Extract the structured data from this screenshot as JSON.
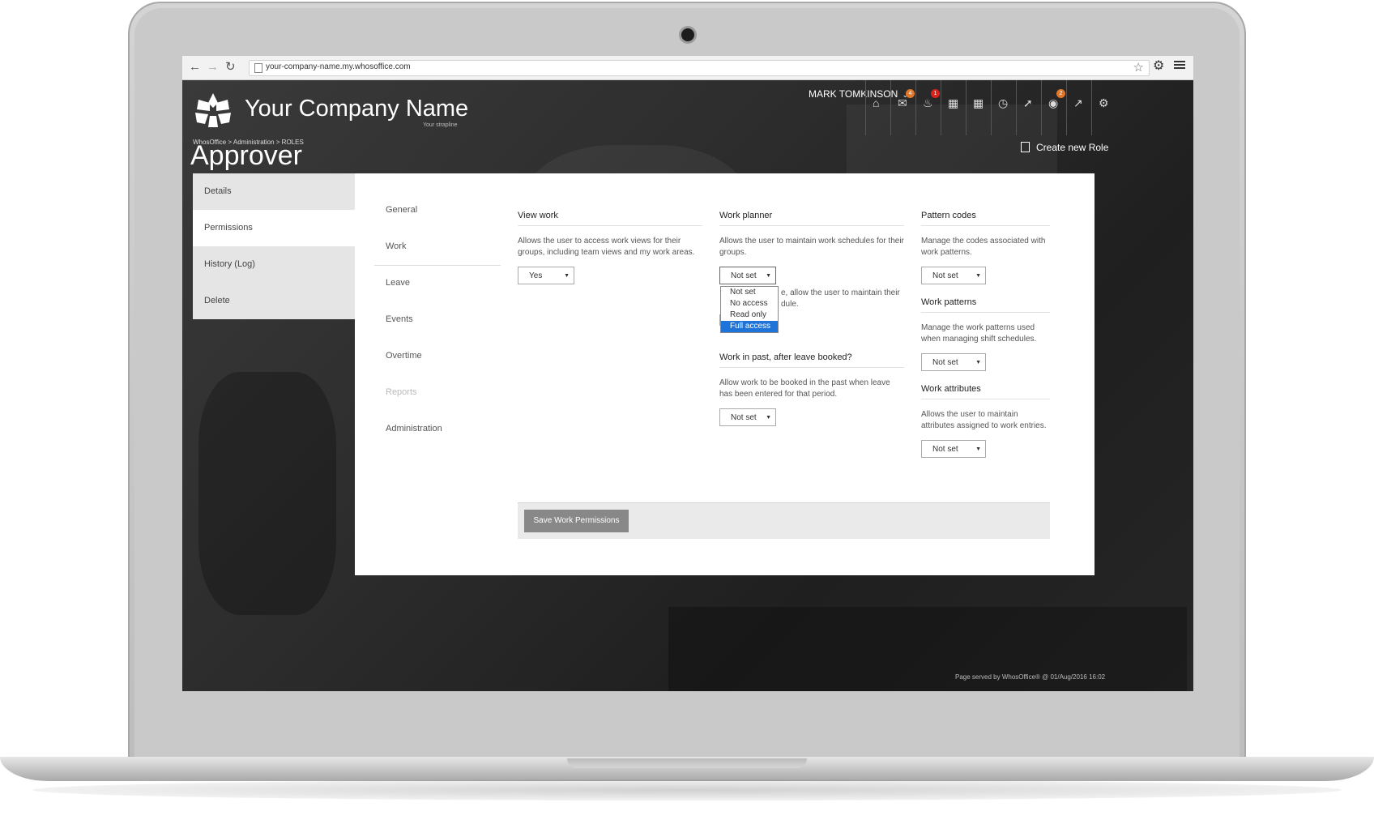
{
  "browser": {
    "url": "your-company-name.my.whosoffice.com",
    "back_icon": "arrow-left-icon",
    "forward_icon": "arrow-right-icon",
    "reload_icon": "reload-icon"
  },
  "header": {
    "company_name": "Your Company Name",
    "strapline": "Your strapline",
    "breadcrumb": "WhosOffice > Administration > ROLES",
    "page_title": "Approver",
    "user_name": "MARK TOMKINSON",
    "create_role": "Create new Role",
    "icons": [
      {
        "name": "home-icon",
        "badge": ""
      },
      {
        "name": "mail-icon",
        "badge": "4"
      },
      {
        "name": "bell-icon",
        "badge": "1"
      },
      {
        "name": "calendar-icon",
        "badge": ""
      },
      {
        "name": "grid-icon",
        "badge": ""
      },
      {
        "name": "clock-icon",
        "badge": ""
      },
      {
        "name": "pin-icon",
        "badge": ""
      },
      {
        "name": "globe-icon",
        "badge": "2"
      },
      {
        "name": "chart-icon",
        "badge": ""
      },
      {
        "name": "gear-icon",
        "badge": ""
      }
    ],
    "badge_colors": {
      "orange": "#e0772a",
      "red": "#d9231c"
    }
  },
  "left_nav": {
    "items": [
      "Details",
      "Permissions",
      "History (Log)",
      "Delete"
    ],
    "active": "Permissions"
  },
  "sub_nav": {
    "items": [
      "General",
      "Work",
      "Leave",
      "Events",
      "Overtime",
      "Reports",
      "Administration"
    ],
    "disabled": "Reports"
  },
  "view_work": {
    "title": "View work",
    "description": "Allows the user to access work views for their groups, including team views and my work areas.",
    "value": "Yes"
  },
  "work_planner": {
    "title": "Work planner",
    "description": "Allows the user to maintain work schedules for their groups.",
    "value": "Not set",
    "options": [
      "Not set",
      "No access",
      "Read only",
      "Full access"
    ],
    "highlighted": "Full access",
    "partial_text_1": "e, allow the user to maintain their",
    "partial_text_2": "dule.",
    "partial_select": "No"
  },
  "work_in_past": {
    "title": "Work in past, after leave booked?",
    "description": "Allow work to be booked in the past when leave has been entered for that period.",
    "value": "Not set"
  },
  "pattern_codes": {
    "title": "Pattern codes",
    "description": "Manage the codes associated with work patterns.",
    "value": "Not set"
  },
  "work_patterns": {
    "title": "Work patterns",
    "description": "Manage the work patterns used when managing shift schedules.",
    "value": "Not set"
  },
  "work_attributes": {
    "title": "Work attributes",
    "description": "Allows the user to maintain attributes assigned to work entries.",
    "value": "Not set"
  },
  "save_button": "Save Work Permissions",
  "footer": "Page served by WhosOffice® @ 01/Aug/2016 16:02",
  "accent_color": "#1e74d8"
}
